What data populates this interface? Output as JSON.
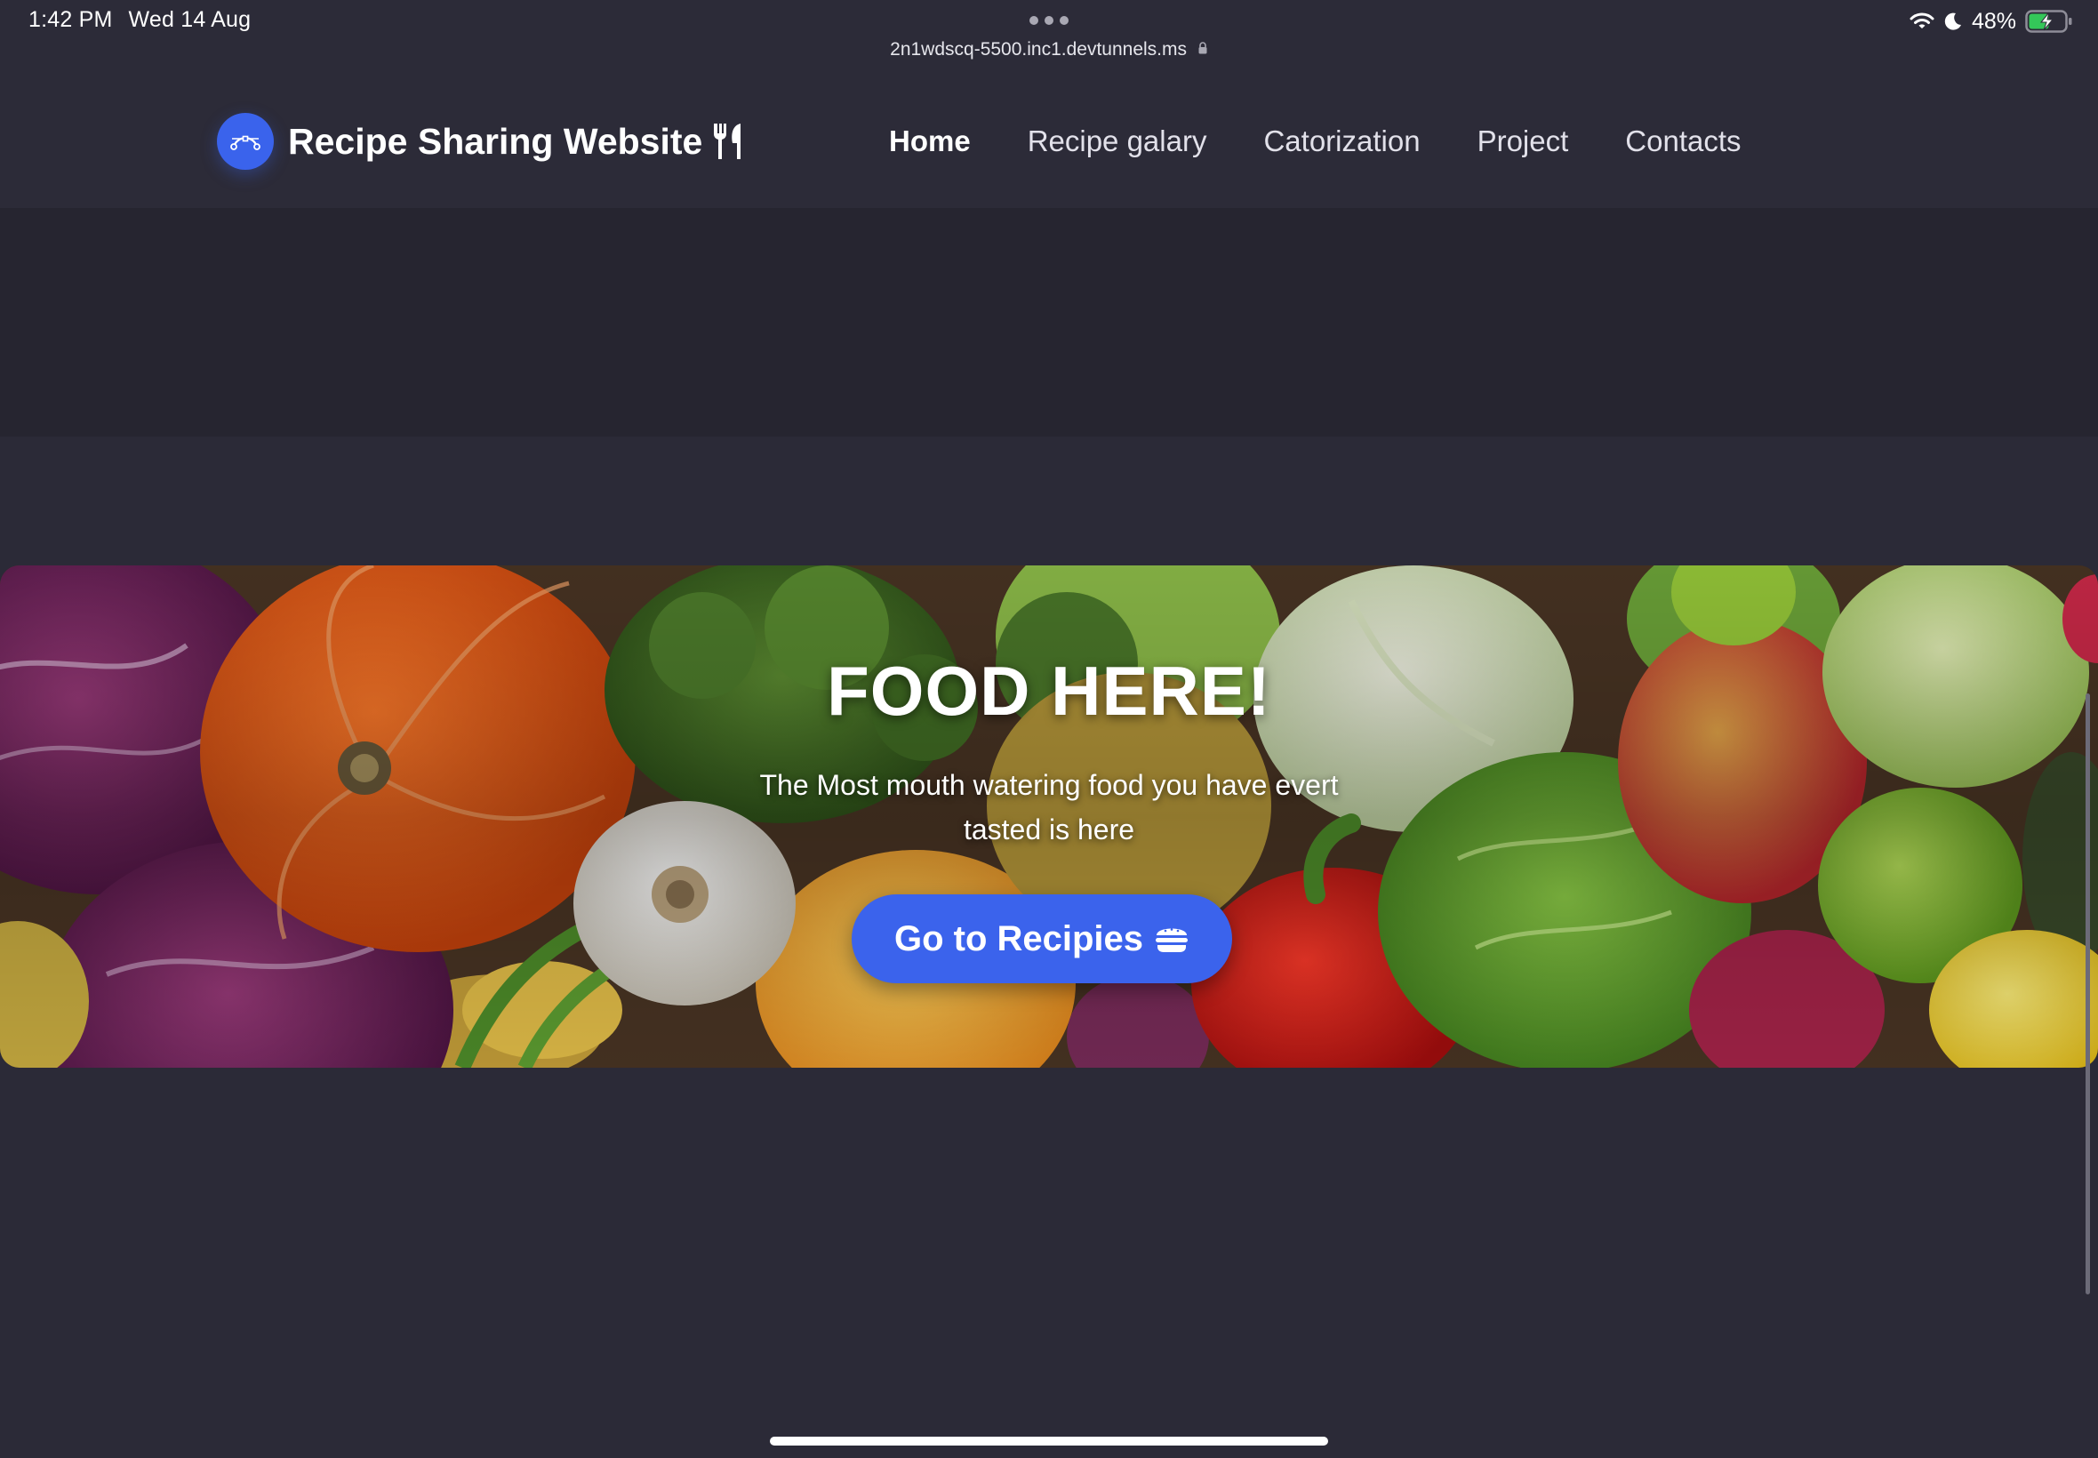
{
  "status_bar": {
    "time": "1:42 PM",
    "date": "Wed 14 Aug",
    "url": "2n1wdscq-5500.inc1.devtunnels.ms",
    "battery": "48%",
    "icons": [
      "wifi-icon",
      "moon-icon",
      "battery-charging-icon",
      "lock-icon"
    ]
  },
  "header": {
    "brand_title": "Recipe Sharing Website",
    "brand_icons": [
      "bezier-logo-icon",
      "utensils-icon"
    ],
    "nav": [
      {
        "label": "Home",
        "active": true
      },
      {
        "label": "Recipe galary",
        "active": false
      },
      {
        "label": "Catorization",
        "active": false
      },
      {
        "label": "Project",
        "active": false
      },
      {
        "label": "Contacts",
        "active": false
      }
    ]
  },
  "hero": {
    "title": "FOOD HERE!",
    "subtitle": "The Most mouth watering food you have evert tasted is here",
    "button_label": "Go to Recipies",
    "button_icon": "burger-icon",
    "image": "fresh-vegetables-photo"
  },
  "colors": {
    "page_bg": "#2b2a37",
    "header_bg": "#2c2b38",
    "band_bg": "#262530",
    "accent": "#3b63ec"
  }
}
